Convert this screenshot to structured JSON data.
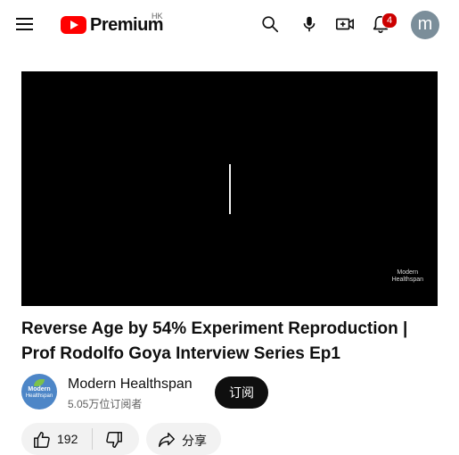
{
  "header": {
    "logo_text": "Premium",
    "region": "HK",
    "notification_count": "4",
    "avatar_letter": "m"
  },
  "video": {
    "watermark_line1": "Modern",
    "watermark_line2": "Healthspan"
  },
  "title": "Reverse Age by 54% Experiment Reproduction | Prof Rodolfo Goya Interview Series Ep1",
  "channel": {
    "avatar_text1": "Modern",
    "avatar_text2": "Healthspan",
    "name": "Modern Healthspan",
    "subscribers": "5.05万位订阅者",
    "subscribe_label": "订阅"
  },
  "actions": {
    "like_count": "192",
    "share_label": "分享"
  },
  "colors": {
    "brand_red": "#ff0000",
    "badge_red": "#cc0000",
    "subscribe_bg": "#0f0f0f"
  },
  "icons": [
    "menu-icon",
    "youtube-logo-icon",
    "search-icon",
    "microphone-icon",
    "create-video-icon",
    "bell-icon",
    "like-icon",
    "dislike-icon",
    "share-icon"
  ]
}
